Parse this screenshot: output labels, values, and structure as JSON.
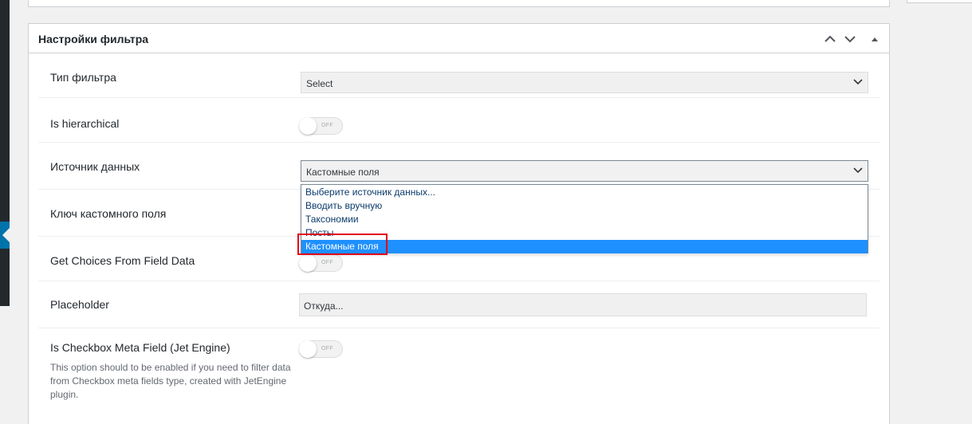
{
  "postbox": {
    "title": "Настройки фильтра"
  },
  "fields": {
    "filter_type": {
      "label": "Тип фильтра",
      "value": "Select"
    },
    "is_hierarchical": {
      "label": "Is hierarchical",
      "state": "OFF"
    },
    "data_source": {
      "label": "Источник данных",
      "value": "Кастомные поля",
      "options": [
        "Выберите источник данных...",
        "Вводить вручную",
        "Таксономии",
        "Посты",
        "Кастомные поля"
      ]
    },
    "custom_field_key": {
      "label": "Ключ кастомного поля"
    },
    "get_choices": {
      "label": "Get Choices From Field Data",
      "state": "OFF"
    },
    "placeholder": {
      "label": "Placeholder",
      "value": "Откуда..."
    },
    "is_checkbox_meta": {
      "label": "Is Checkbox Meta Field (Jet Engine)",
      "state": "OFF",
      "description": "This option should to be enabled if you need to filter data from Checkbox meta fields type, created with JetEngine plugin."
    }
  },
  "colors": {
    "selected_option": "#1e90ff",
    "highlight_border": "#e0001b",
    "admin_accent": "#0073aa"
  },
  "icons": [
    "chevron-up-icon",
    "chevron-down-icon",
    "triangle-up-icon",
    "select-chevron-icon"
  ]
}
